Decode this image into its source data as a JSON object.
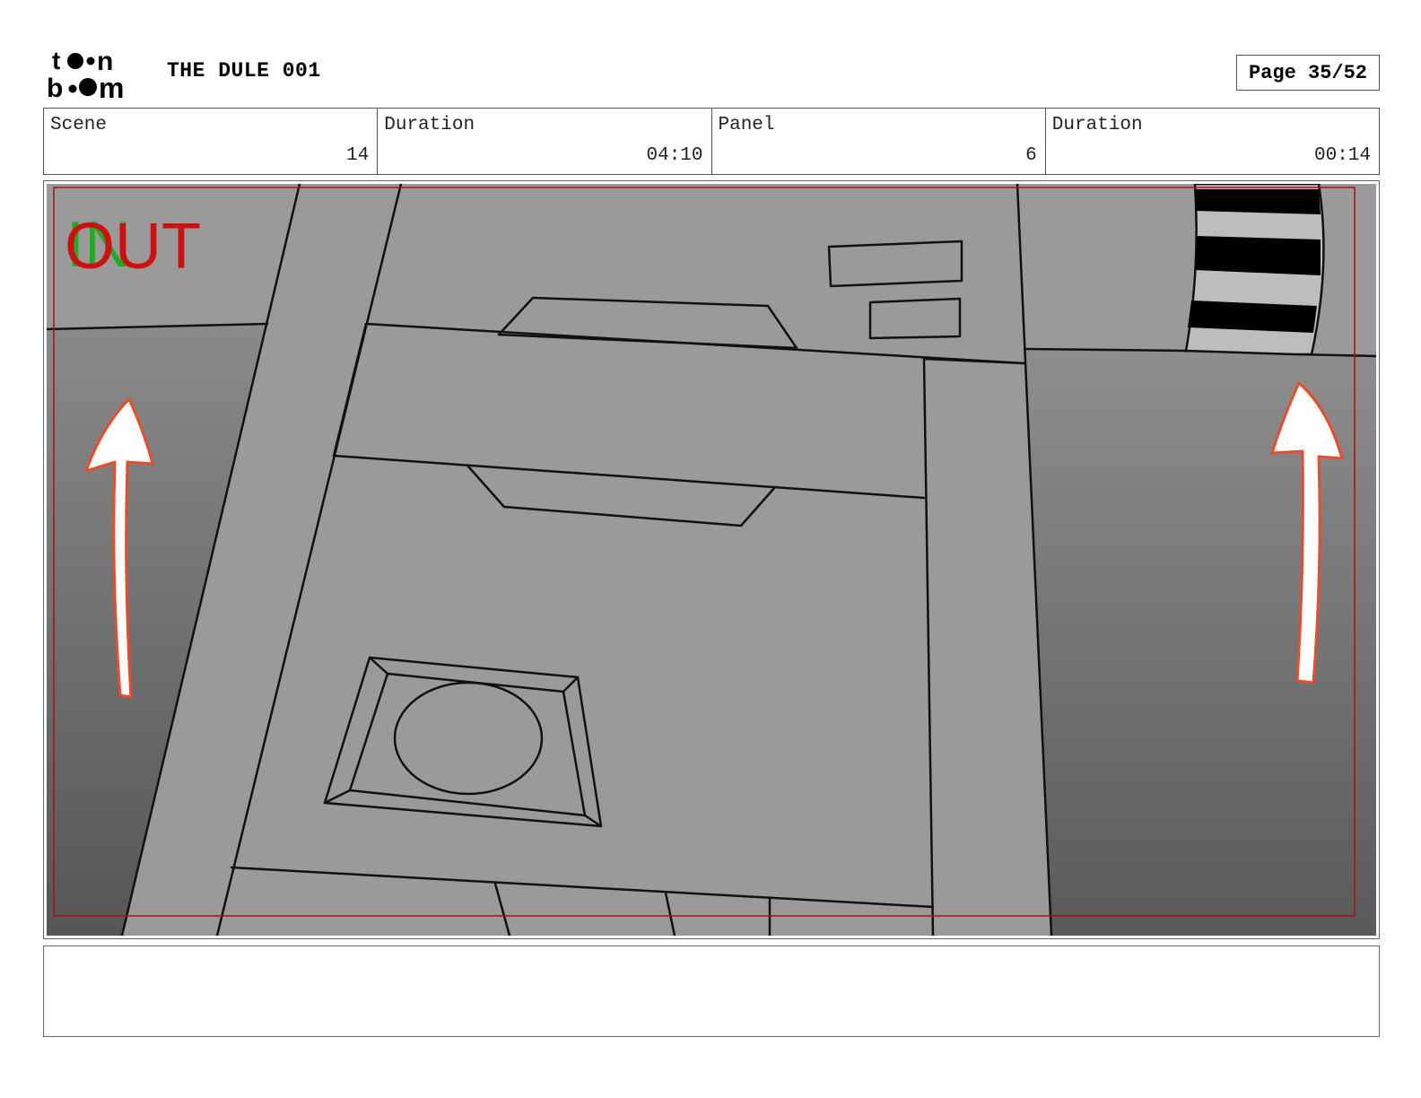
{
  "header": {
    "logo_text": "toon boom",
    "project_title": "THE DULE 001",
    "page_label": "Page 35/52"
  },
  "info": {
    "scene_label": "Scene",
    "scene_value": "14",
    "scene_duration_label": "Duration",
    "scene_duration_value": "04:10",
    "panel_label": "Panel",
    "panel_value": "6",
    "panel_duration_label": "Duration",
    "panel_duration_value": "00:14"
  },
  "panel": {
    "in_marker": "IN",
    "out_marker": "OUT"
  },
  "notes": {
    "text": ""
  },
  "colors": {
    "in_marker": "#22aa22",
    "out_marker": "#cc1111",
    "safe_frame": "#aa1111"
  }
}
